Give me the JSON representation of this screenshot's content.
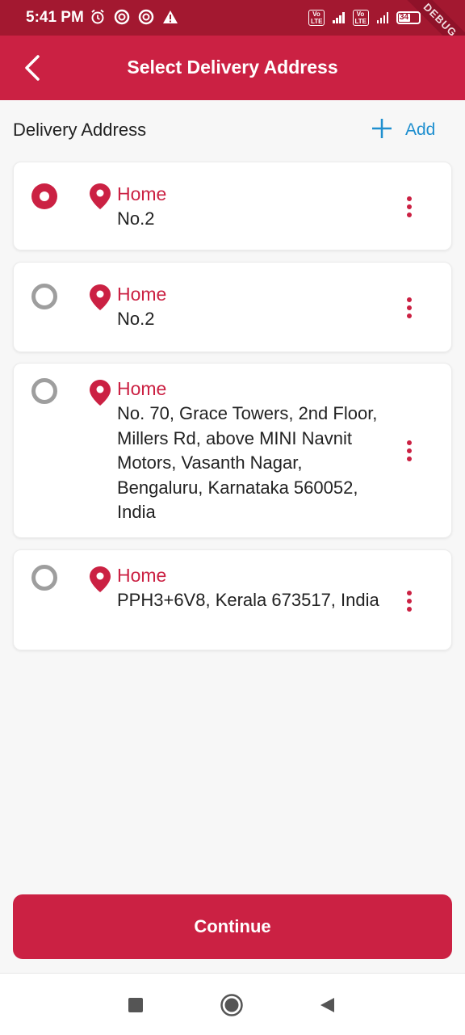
{
  "status": {
    "time": "5:41 PM",
    "battery": "34",
    "debug": "DEBUG"
  },
  "app_bar": {
    "title": "Select Delivery Address"
  },
  "section": {
    "title": "Delivery Address",
    "add_label": "Add",
    "add_icon": "plus"
  },
  "addresses": [
    {
      "label": "Home",
      "text": "No.2",
      "selected": true
    },
    {
      "label": "Home",
      "text": "No.2",
      "selected": false
    },
    {
      "label": "Home",
      "text": "No. 70, Grace Towers, 2nd Floor, Millers Rd, above MINI Navnit Motors, Vasanth Nagar, Bengaluru, Karnataka 560052, India",
      "selected": false
    },
    {
      "label": "Home",
      "text": "PPH3+6V8, Kerala 673517, India",
      "selected": false
    }
  ],
  "continue_label": "Continue",
  "colors": {
    "primary": "#cb2143",
    "status_bar": "#a31830",
    "link": "#1f8fcf"
  }
}
